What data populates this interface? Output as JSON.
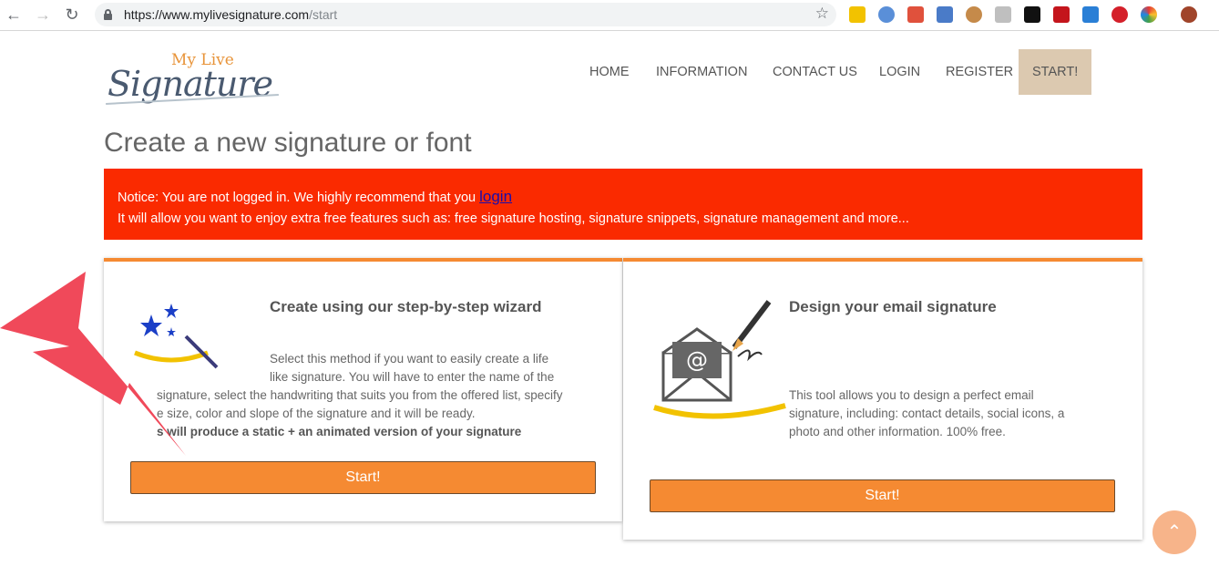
{
  "browser": {
    "url_host": "https://www.mylivesignature.com",
    "url_path": "/start"
  },
  "logo": {
    "top": "My Live",
    "main": "Signature"
  },
  "nav": {
    "home": "HOME",
    "information": "INFORMATION",
    "contact": "CONTACT US",
    "login": "LOGIN",
    "register": "REGISTER",
    "start": "START!"
  },
  "page": {
    "title": "Create a new signature or font"
  },
  "notice": {
    "line1_prefix": "Notice: You are not logged in. We highly recommend that you ",
    "login_link": "login",
    "line2": "It will allow you want to enjoy extra free features such as: free signature hosting, signature snippets, signature management and more..."
  },
  "wizard_card": {
    "title": "Create using our step-by-step wizard",
    "text_line1": "Select this method if you want to easily create a life",
    "text_line2": "like signature. You will have to enter the name of the",
    "text_line3": "signature, select the handwriting that suits you from the offered list, specify",
    "text_line4": "e size, color and slope of the signature and it will be ready.",
    "text_bold": "s will produce a static + an animated version of your signature",
    "button": "Start!"
  },
  "email_card": {
    "title": "Design your email signature",
    "text_line1": "This tool allows you to design a perfect email",
    "text_line2": "signature, including: contact details, social icons, a",
    "text_line3": "photo and other information. 100% free.",
    "button": "Start!",
    "at_symbol": "@"
  },
  "scroll_top": {
    "icon": "chevron-up-icon"
  },
  "colors": {
    "accent": "#f58a32",
    "notice": "#fa2a00",
    "start_nav": "#dcc9b0",
    "arrow": "#f0495a"
  }
}
